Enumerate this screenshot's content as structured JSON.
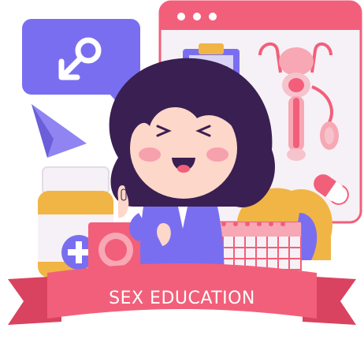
{
  "banner": {
    "label": "SEX EDUCATION"
  },
  "palette": {
    "pink": "#f25f7a",
    "purple": "#7a6ef0",
    "hair": "#3a1f52",
    "panel": "#f4eff4",
    "yellow": "#f1b545"
  },
  "icons": [
    "male-symbol-icon",
    "window-dots-icon",
    "clipboard-icon",
    "reproductive-diagram-icon",
    "paper-plane-icon",
    "pill-capsule-icon",
    "medicine-bottle-icon",
    "condom-pack-icon",
    "calendar-icon"
  ]
}
